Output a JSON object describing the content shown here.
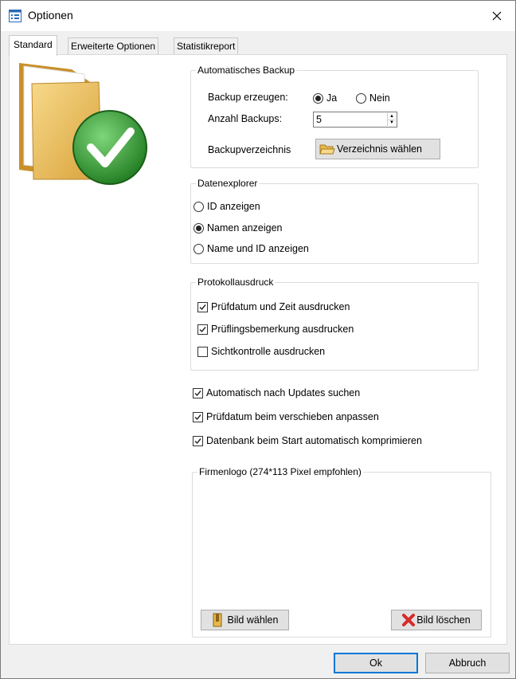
{
  "window": {
    "title": "Optionen"
  },
  "tabs": [
    {
      "label": "Standard",
      "active": true
    },
    {
      "label": "Erweiterte Optionen",
      "active": false
    },
    {
      "label": "Statistikreport",
      "active": false
    }
  ],
  "backup": {
    "group_title": "Automatisches Backup",
    "create_label": "Backup erzeugen:",
    "yes_label": "Ja",
    "no_label": "Nein",
    "yes_selected": true,
    "count_label": "Anzahl Backups:",
    "count_value": "5",
    "dir_label": "Backupverzeichnis",
    "dir_button": "Verzeichnis wählen"
  },
  "explorer": {
    "group_title": "Datenexplorer",
    "options": [
      {
        "label": "ID anzeigen",
        "selected": false
      },
      {
        "label": "Namen anzeigen",
        "selected": true
      },
      {
        "label": "Name und ID anzeigen",
        "selected": false
      }
    ]
  },
  "protocol": {
    "group_title": "Protokollausdruck",
    "options": [
      {
        "label": "Prüfdatum und Zeit ausdrucken",
        "checked": true
      },
      {
        "label": "Prüflingsbemerkung ausdrucken",
        "checked": true
      },
      {
        "label": "Sichtkontrolle ausdrucken",
        "checked": false
      }
    ]
  },
  "general": [
    {
      "label": "Automatisch nach Updates suchen",
      "checked": true
    },
    {
      "label": "Prüfdatum beim verschieben anpassen",
      "checked": true
    },
    {
      "label": "Datenbank beim Start automatisch komprimieren",
      "checked": true
    }
  ],
  "logo": {
    "group_title": "Firmenlogo (274*113 Pixel empfohlen)",
    "choose_button": "Bild wählen",
    "delete_button": "Bild löschen"
  },
  "footer": {
    "ok": "Ok",
    "cancel": "Abbruch"
  },
  "colors": {
    "accent": "#0078d7",
    "check_green": "#2e9b2e",
    "folder": "#e8b84a",
    "delete_red": "#d62b2b"
  }
}
